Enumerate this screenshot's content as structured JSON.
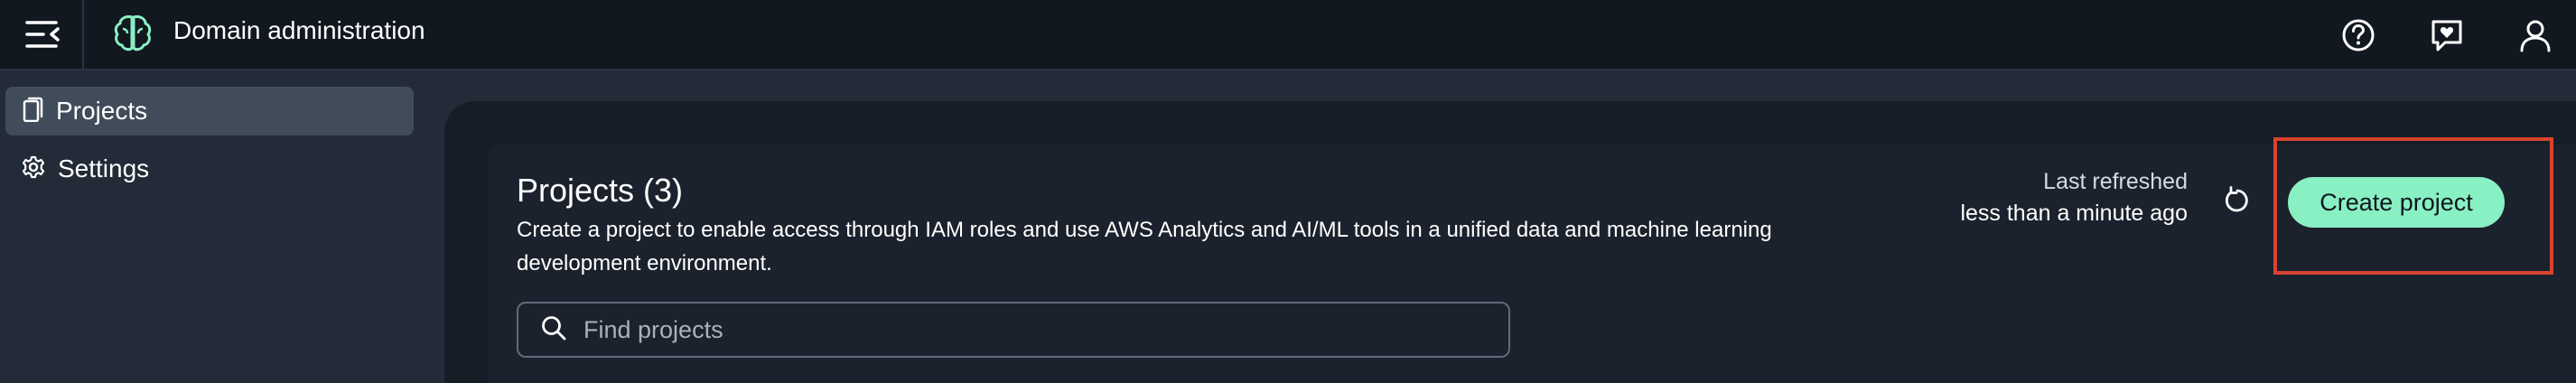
{
  "header": {
    "title": "Domain administration",
    "icons": [
      "menu-collapse-icon",
      "app-logo-icon",
      "help-icon",
      "feedback-icon",
      "user-profile-icon"
    ]
  },
  "sidebar": {
    "items": [
      {
        "label": "Projects",
        "icon": "projects-icon",
        "active": true
      },
      {
        "label": "Settings",
        "icon": "gear-icon",
        "active": false
      }
    ]
  },
  "main": {
    "title": "Projects (3)",
    "description": "Create a project to enable access through IAM roles and use AWS Analytics and AI/ML tools in a unified data and machine learning development environment.",
    "refresh": {
      "label": "Last refreshed",
      "value": "less than a minute ago"
    },
    "create_button": "Create project",
    "search": {
      "placeholder": "Find projects",
      "value": ""
    }
  },
  "colors": {
    "topbar_bg": "#121820",
    "page_bg": "#222b37",
    "card_bg": "#1b222d",
    "accent_button": "#89f0c3",
    "highlight_border": "#d8432f",
    "logo": "#89f0c3"
  }
}
